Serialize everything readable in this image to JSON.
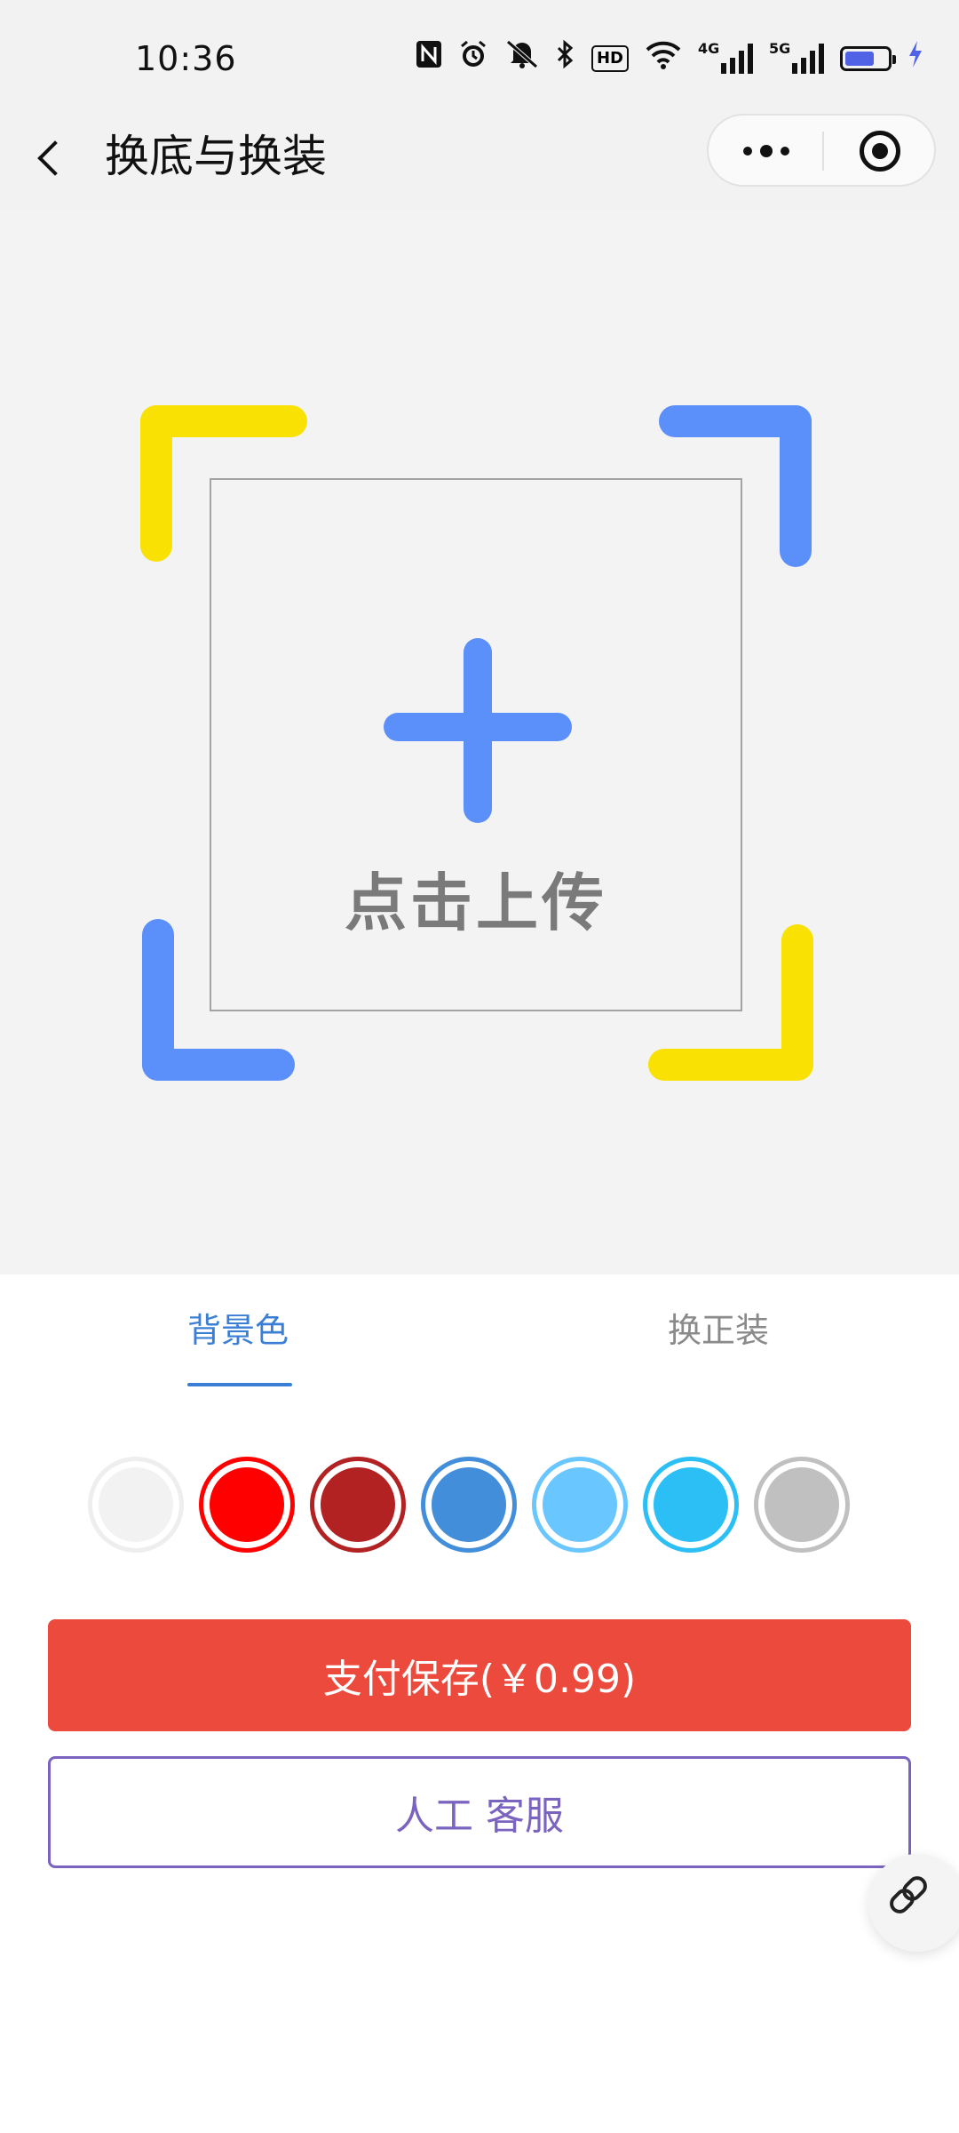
{
  "status_bar": {
    "time": "10:36",
    "icons": [
      "nfc-icon",
      "alarm-icon",
      "mute-icon",
      "bluetooth-icon",
      "hd-icon",
      "wifi-icon",
      "signal-4g-icon",
      "signal-5g-icon",
      "battery-icon",
      "charging-icon"
    ],
    "hd_label": "HD",
    "sig1_label": "4G",
    "sig2_label": "5G",
    "battery_level": 0.7
  },
  "nav": {
    "title": "换底与换装",
    "back_icon": "chevron-left-icon",
    "more_icon": "more-dots-icon",
    "close_icon": "target-circle-icon"
  },
  "upload": {
    "label": "点击上传",
    "icon": "plus-icon",
    "corner_colors": {
      "top_left": "#f9e103",
      "top_right": "#5b8ff9",
      "bottom_left": "#5b8ff9",
      "bottom_right": "#f9e103"
    }
  },
  "tabs": [
    {
      "label": "背景色",
      "active": true
    },
    {
      "label": "换正装",
      "active": false
    }
  ],
  "swatches": [
    {
      "color": "#f2f2f2",
      "ring": "#eeeeee"
    },
    {
      "color": "#ff0000",
      "ring": "#ff0000"
    },
    {
      "color": "#b22222",
      "ring": "#b22222"
    },
    {
      "color": "#438edb",
      "ring": "#438edb"
    },
    {
      "color": "#6ac6ff",
      "ring": "#6ac6ff"
    },
    {
      "color": "#2bbff5",
      "ring": "#2bbff5"
    },
    {
      "color": "#c0c0c0",
      "ring": "#c0c0c0"
    }
  ],
  "actions": {
    "pay_label": "支付保存(￥0.99)",
    "service_label": "人工 客服"
  },
  "float_button": {
    "icon": "link-icon"
  },
  "colors": {
    "accent_blue": "#3a7fd5",
    "pay_red": "#ed4a3e",
    "service_purple": "#7b64c0"
  }
}
